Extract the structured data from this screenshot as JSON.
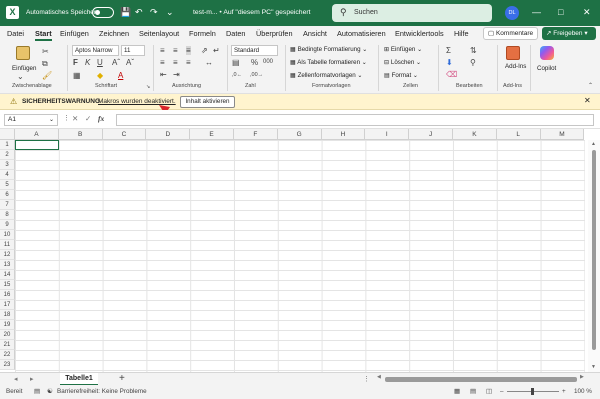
{
  "titlebar": {
    "autosave_label": "Automatisches Speichern",
    "doc_title": "test-m... • Auf \"diesem PC\" gespeichert",
    "search_placeholder": "Suchen",
    "user_initials": "DL"
  },
  "menu": {
    "tabs": [
      "Datei",
      "Start",
      "Einfügen",
      "Zeichnen",
      "Seitenlayout",
      "Formeln",
      "Daten",
      "Überprüfen",
      "Ansicht",
      "Automatisieren",
      "Entwicklertools",
      "Hilfe"
    ],
    "active_tab": "Start",
    "comments_label": "Kommentare",
    "share_label": "Freigeben"
  },
  "ribbon": {
    "clipboard": {
      "paste": "Einfügen",
      "label": "Zwischenablage"
    },
    "font": {
      "name": "Aptos Narrow",
      "size": "11",
      "label": "Schriftart"
    },
    "alignment": {
      "label": "Ausrichtung"
    },
    "number": {
      "format": "Standard",
      "label": "Zahl"
    },
    "styles": {
      "cond": "Bedingte Formatierung",
      "table": "Als Tabelle formatieren",
      "cell": "Zellenformatvorlagen",
      "label": "Formatvorlagen"
    },
    "cells": {
      "insert": "Einfügen",
      "delete": "Löschen",
      "format": "Format",
      "label": "Zellen"
    },
    "editing": {
      "label": "Bearbeiten"
    },
    "addins": {
      "button": "Add-Ins",
      "label": "Add-Ins"
    },
    "copilot": {
      "label": "Copilot"
    }
  },
  "security_bar": {
    "title": "SICHERHEITSWARNUNG",
    "message": "Makros wurden deaktiviert.",
    "button": "Inhalt aktivieren"
  },
  "formula_bar": {
    "name_box": "A1",
    "fx": "fx",
    "value": ""
  },
  "grid": {
    "columns": [
      "A",
      "B",
      "C",
      "D",
      "E",
      "F",
      "G",
      "H",
      "I",
      "J",
      "K",
      "L",
      "M"
    ],
    "rows": [
      "1",
      "2",
      "3",
      "4",
      "5",
      "6",
      "7",
      "8",
      "9",
      "10",
      "11",
      "12",
      "13",
      "14",
      "15",
      "16",
      "17",
      "18",
      "19",
      "20",
      "21",
      "22",
      "23"
    ]
  },
  "sheets": {
    "tabs": [
      "Tabelle1"
    ],
    "add": "+"
  },
  "status": {
    "mode": "Bereit",
    "accessibility": "Barrierefreiheit: Keine Probleme",
    "zoom": "100 %"
  },
  "colors": {
    "brand": "#1e7145",
    "warning_bg": "#fff4ce",
    "arrow": "#d9252b"
  }
}
